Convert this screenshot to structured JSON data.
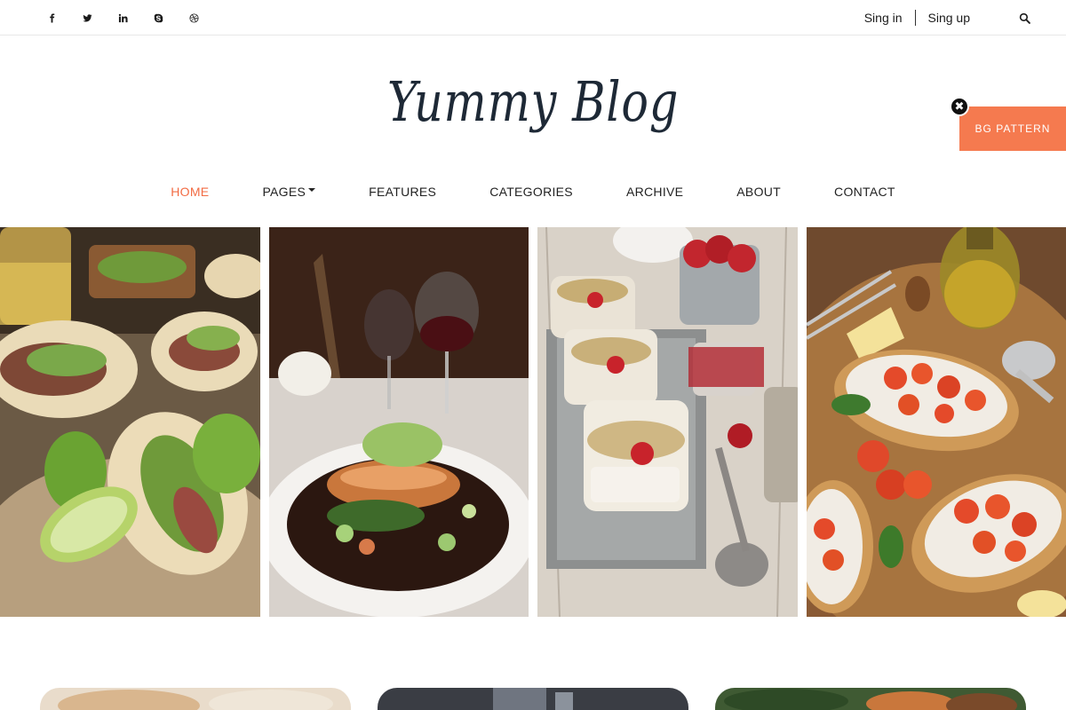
{
  "social": [
    {
      "name": "facebook-icon"
    },
    {
      "name": "twitter-icon"
    },
    {
      "name": "linkedin-icon"
    },
    {
      "name": "skype-icon"
    },
    {
      "name": "dribbble-icon"
    }
  ],
  "auth": {
    "sign_in": "Sing in",
    "sign_up": "Sing up"
  },
  "logo": {
    "text": "Yummy Blog"
  },
  "bg_pattern": {
    "label": "BG PATTERN",
    "close": "✖"
  },
  "nav": {
    "items": [
      {
        "label": "HOME",
        "active": true
      },
      {
        "label": "PAGES",
        "dropdown": true
      },
      {
        "label": "FEATURES"
      },
      {
        "label": "CATEGORIES"
      },
      {
        "label": "ARCHIVE"
      },
      {
        "label": "ABOUT"
      },
      {
        "label": "CONTACT"
      }
    ]
  },
  "colors": {
    "accent": "#f26b43",
    "tab_bg": "#f57a4f",
    "logo": "#1e2936"
  }
}
